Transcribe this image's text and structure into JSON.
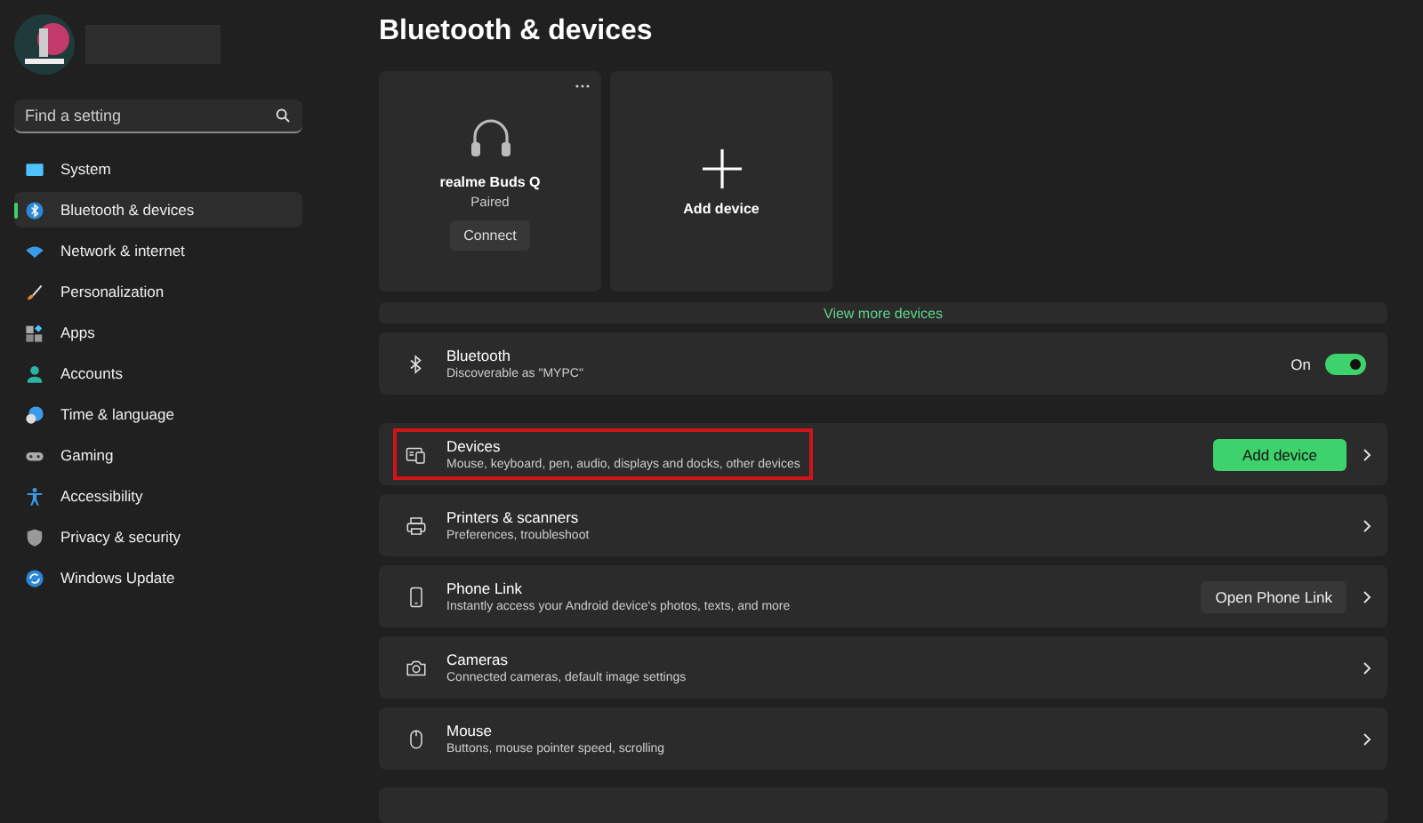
{
  "sidebar": {
    "search": {
      "placeholder": "Find a setting"
    },
    "items": [
      {
        "label": "System",
        "selected": false
      },
      {
        "label": "Bluetooth & devices",
        "selected": true
      },
      {
        "label": "Network & internet",
        "selected": false
      },
      {
        "label": "Personalization",
        "selected": false
      },
      {
        "label": "Apps",
        "selected": false
      },
      {
        "label": "Accounts",
        "selected": false
      },
      {
        "label": "Time & language",
        "selected": false
      },
      {
        "label": "Gaming",
        "selected": false
      },
      {
        "label": "Accessibility",
        "selected": false
      },
      {
        "label": "Privacy & security",
        "selected": false
      },
      {
        "label": "Windows Update",
        "selected": false
      }
    ]
  },
  "page_title": "Bluetooth & devices",
  "device_cards": [
    {
      "kind": "device",
      "name": "realme Buds Q",
      "status": "Paired",
      "button": "Connect"
    },
    {
      "kind": "add",
      "name": "Add device"
    }
  ],
  "view_more": "View more devices",
  "rows": [
    {
      "kind": "toggle",
      "title": "Bluetooth",
      "subtitle": "Discoverable as \"MYPC\"",
      "toggle_label": "On",
      "on": true,
      "highlighted": false
    },
    {
      "kind": "button",
      "title": "Devices",
      "subtitle": "Mouse, keyboard, pen, audio, displays and docks, other devices",
      "button": "Add device",
      "primary": true,
      "highlighted": true
    },
    {
      "kind": "chevron",
      "title": "Printers & scanners",
      "subtitle": "Preferences, troubleshoot",
      "highlighted": false
    },
    {
      "kind": "button",
      "title": "Phone Link",
      "subtitle": "Instantly access your Android device's photos, texts, and more",
      "button": "Open Phone Link",
      "primary": false,
      "highlighted": false
    },
    {
      "kind": "chevron",
      "title": "Cameras",
      "subtitle": "Connected cameras, default image settings",
      "highlighted": false
    },
    {
      "kind": "chevron",
      "title": "Mouse",
      "subtitle": "Buttons, mouse pointer speed, scrolling",
      "highlighted": false
    }
  ]
}
